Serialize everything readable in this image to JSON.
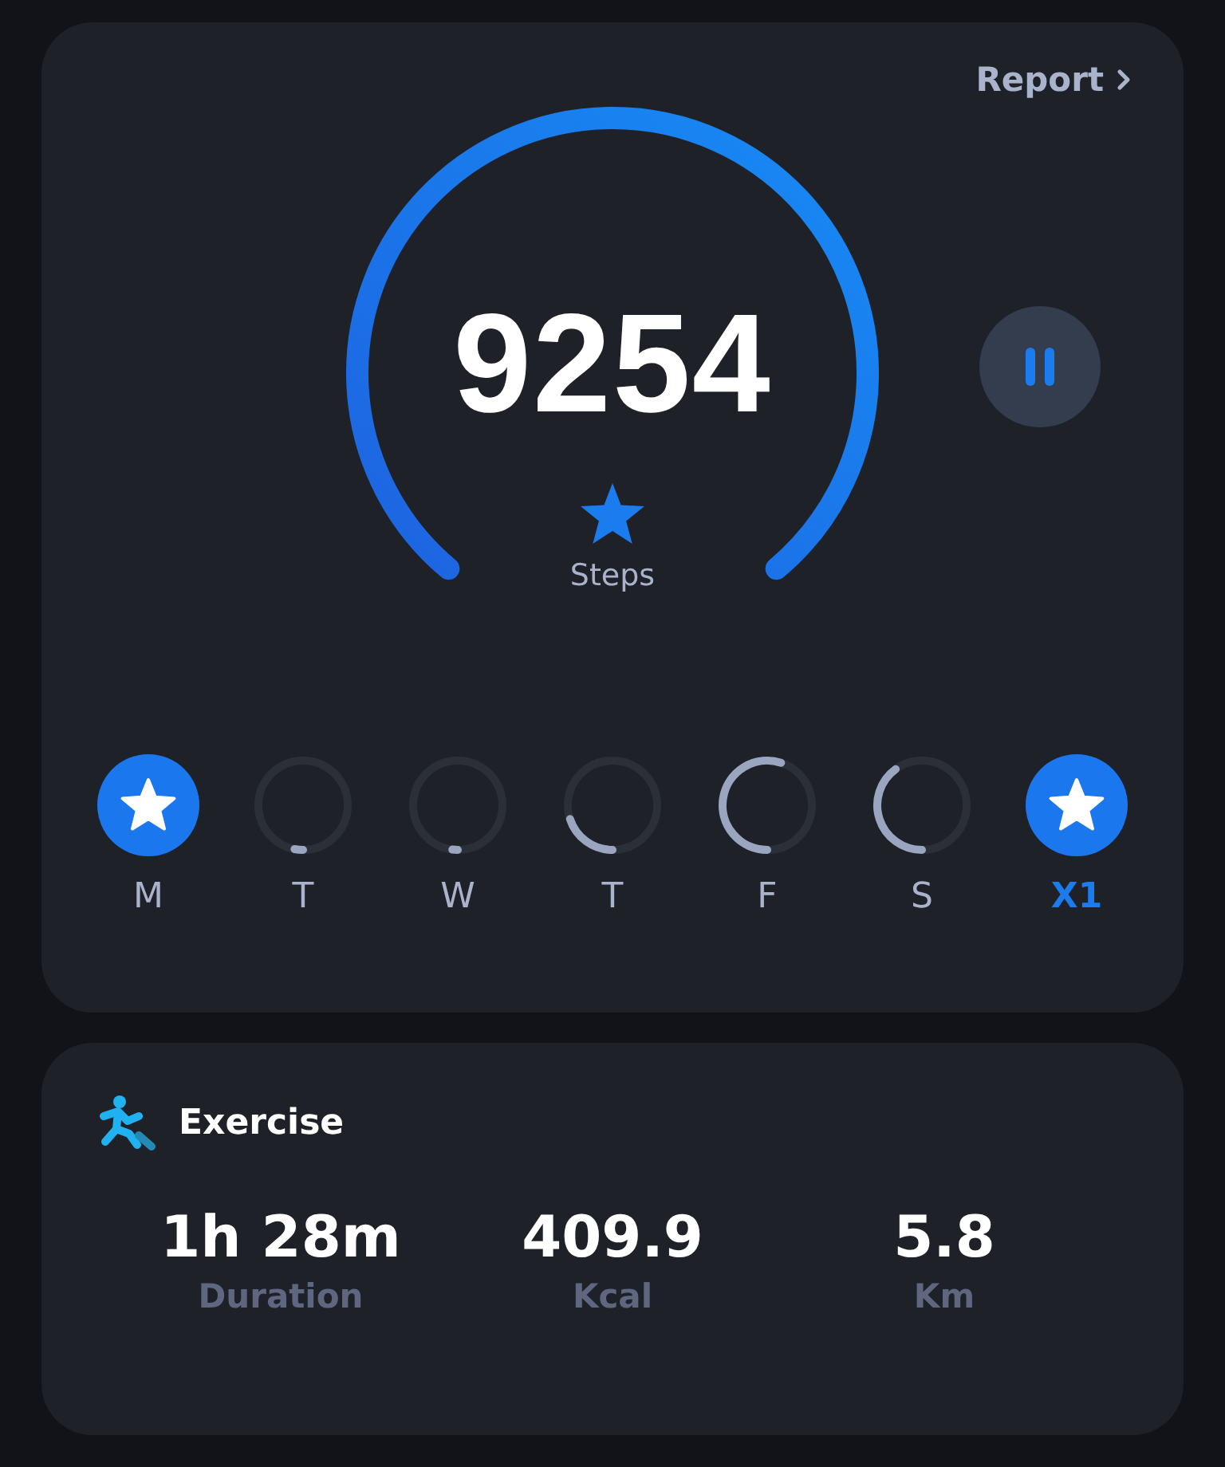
{
  "report_link": {
    "label": "Report"
  },
  "steps": {
    "value": "9254",
    "label": "Steps",
    "goal_met": true
  },
  "pause_button": {
    "paused": false
  },
  "days": [
    {
      "label": "M",
      "goal_met": true,
      "selected": false
    },
    {
      "label": "T",
      "goal_met": false,
      "selected": false
    },
    {
      "label": "W",
      "goal_met": false,
      "selected": false
    },
    {
      "label": "T",
      "goal_met": false,
      "selected": false
    },
    {
      "label": "F",
      "goal_met": false,
      "selected": false
    },
    {
      "label": "S",
      "goal_met": false,
      "selected": false
    },
    {
      "label": "X1",
      "goal_met": true,
      "selected": true
    }
  ],
  "exercise": {
    "title": "Exercise",
    "stats": [
      {
        "value": "1h 28m",
        "label": "Duration"
      },
      {
        "value": "409.9",
        "label": "Kcal"
      },
      {
        "value": "5.8",
        "label": "Km"
      }
    ]
  }
}
